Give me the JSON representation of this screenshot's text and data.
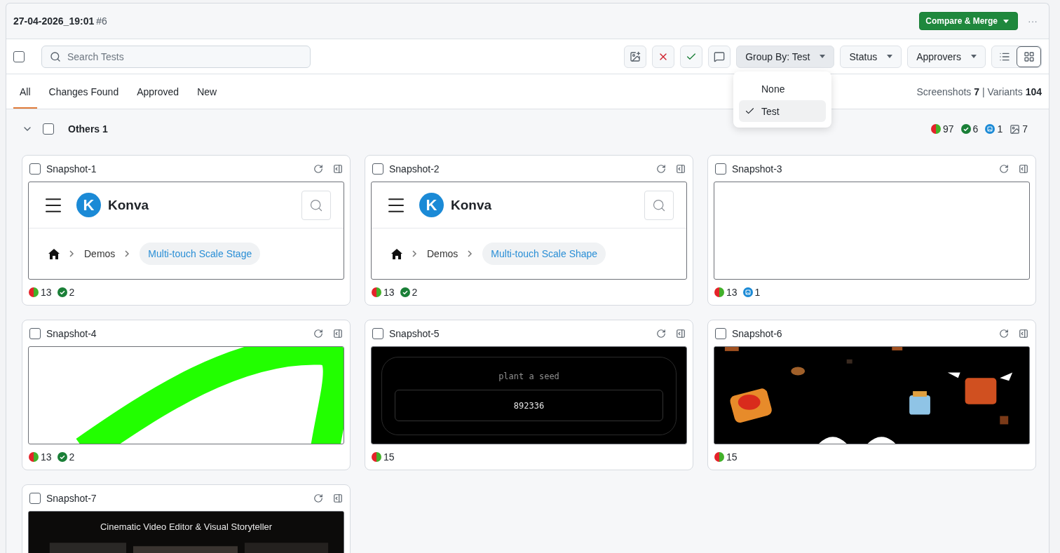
{
  "header": {
    "title": "27-04-2026_19:01",
    "build": "#6",
    "primary_button": "Compare & Merge",
    "more": "···"
  },
  "toolbar": {
    "select_all_checked": false,
    "search": {
      "placeholder": "Search Tests"
    },
    "actions": [
      {
        "kind": "add-image"
      },
      {
        "kind": "reject"
      },
      {
        "kind": "approve"
      },
      {
        "kind": "comment"
      }
    ],
    "filters": [
      {
        "label": "Group By: Test",
        "open": true
      },
      {
        "label": "Status",
        "open": false
      },
      {
        "label": "Approvers",
        "open": false
      }
    ],
    "views": [
      {
        "kind": "list",
        "selected": false
      },
      {
        "kind": "grid",
        "selected": true
      }
    ],
    "dropdown": {
      "options": [
        {
          "label": "None",
          "selected": false
        },
        {
          "label": "Test",
          "selected": true
        }
      ]
    }
  },
  "tabs": [
    {
      "label": "All",
      "selected": true
    },
    {
      "label": "Changes Found",
      "selected": false
    },
    {
      "label": "Approved",
      "selected": false
    },
    {
      "label": "New",
      "selected": false
    }
  ],
  "summary": "Screenshots **7** | Variants **104**",
  "group": {
    "title": "Others 1",
    "expanded": true,
    "checked": false,
    "stats": [
      {
        "kind": "changed",
        "count": "97"
      },
      {
        "kind": "approved",
        "count": "6"
      },
      {
        "kind": "new",
        "count": "1"
      },
      {
        "kind": "screenshots",
        "count": "7"
      }
    ]
  },
  "snapshots": [
    {
      "name": "Snapshot-1",
      "checked": false,
      "preview": {
        "kind": "konva",
        "brand": "Konva",
        "logo_letter": "K",
        "crumbs": [
          "Demos",
          "Multi-touch Scale Stage"
        ]
      },
      "badges": [
        {
          "kind": "changed",
          "count": "13"
        },
        {
          "kind": "approved",
          "count": "2"
        }
      ]
    },
    {
      "name": "Snapshot-2",
      "checked": false,
      "preview": {
        "kind": "konva",
        "brand": "Konva",
        "logo_letter": "K",
        "crumbs": [
          "Demos",
          "Multi-touch Scale Shape"
        ]
      },
      "badges": [
        {
          "kind": "changed",
          "count": "13"
        },
        {
          "kind": "approved",
          "count": "2"
        }
      ]
    },
    {
      "name": "Snapshot-3",
      "checked": false,
      "preview": {
        "kind": "blank"
      },
      "badges": [
        {
          "kind": "changed",
          "count": "13"
        },
        {
          "kind": "new",
          "count": "1"
        }
      ]
    },
    {
      "name": "Snapshot-4",
      "checked": false,
      "preview": {
        "kind": "stroke"
      },
      "badges": [
        {
          "kind": "changed",
          "count": "13"
        },
        {
          "kind": "approved",
          "count": "2"
        }
      ]
    },
    {
      "name": "Snapshot-5",
      "checked": false,
      "preview": {
        "kind": "seed",
        "label": "plant a seed",
        "value": "892336"
      },
      "badges": [
        {
          "kind": "changed",
          "count": "15"
        }
      ]
    },
    {
      "name": "Snapshot-6",
      "checked": false,
      "preview": {
        "kind": "picture"
      },
      "badges": [
        {
          "kind": "changed",
          "count": "15"
        }
      ]
    },
    {
      "name": "Snapshot-7",
      "checked": false,
      "preview": {
        "kind": "hero",
        "title": "Cinematic Video Editor & Visual Storyteller"
      }
    }
  ]
}
